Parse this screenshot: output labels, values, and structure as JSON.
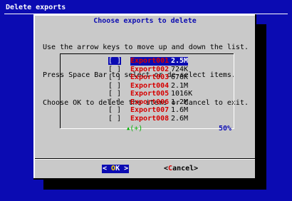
{
  "backtitle": "Delete exports",
  "dialog": {
    "title": "Choose exports to delete",
    "prompt": [
      "Use the arrow keys to move up and down the list.",
      "Press Space Bar to select or de-select items.",
      "Choose OK to delete the items or Cancel to exit."
    ],
    "items": [
      {
        "check": "[ ]",
        "name": "Export001",
        "size": "2.5M",
        "selected": true
      },
      {
        "check": "[ ]",
        "name": "Export002",
        "size": "724K",
        "selected": false
      },
      {
        "check": "[ ]",
        "name": "Export003",
        "size": "676K",
        "selected": false
      },
      {
        "check": "[ ]",
        "name": "Export004",
        "size": "2.1M",
        "selected": false
      },
      {
        "check": "[ ]",
        "name": "Export005",
        "size": "1016K",
        "selected": false
      },
      {
        "check": "[ ]",
        "name": "Export006",
        "size": "1.2M",
        "selected": false
      },
      {
        "check": "[ ]",
        "name": "Export007",
        "size": "1.6M",
        "selected": false
      },
      {
        "check": "[ ]",
        "name": "Export008",
        "size": "2.6M",
        "selected": false
      }
    ],
    "more_indicator": "(+)",
    "scroll_percent": "50%",
    "buttons": {
      "ok": {
        "left": "< ",
        "hot": "O",
        "rest": "K",
        "right": " >"
      },
      "cancel": {
        "left": "<",
        "hot": "C",
        "rest": "ancel",
        "right": ">"
      }
    }
  },
  "colors": {
    "background": "#0b0bb2",
    "dialog": "#c9c9c9",
    "hotkey": "#d60000",
    "indicator": "#00b000"
  }
}
